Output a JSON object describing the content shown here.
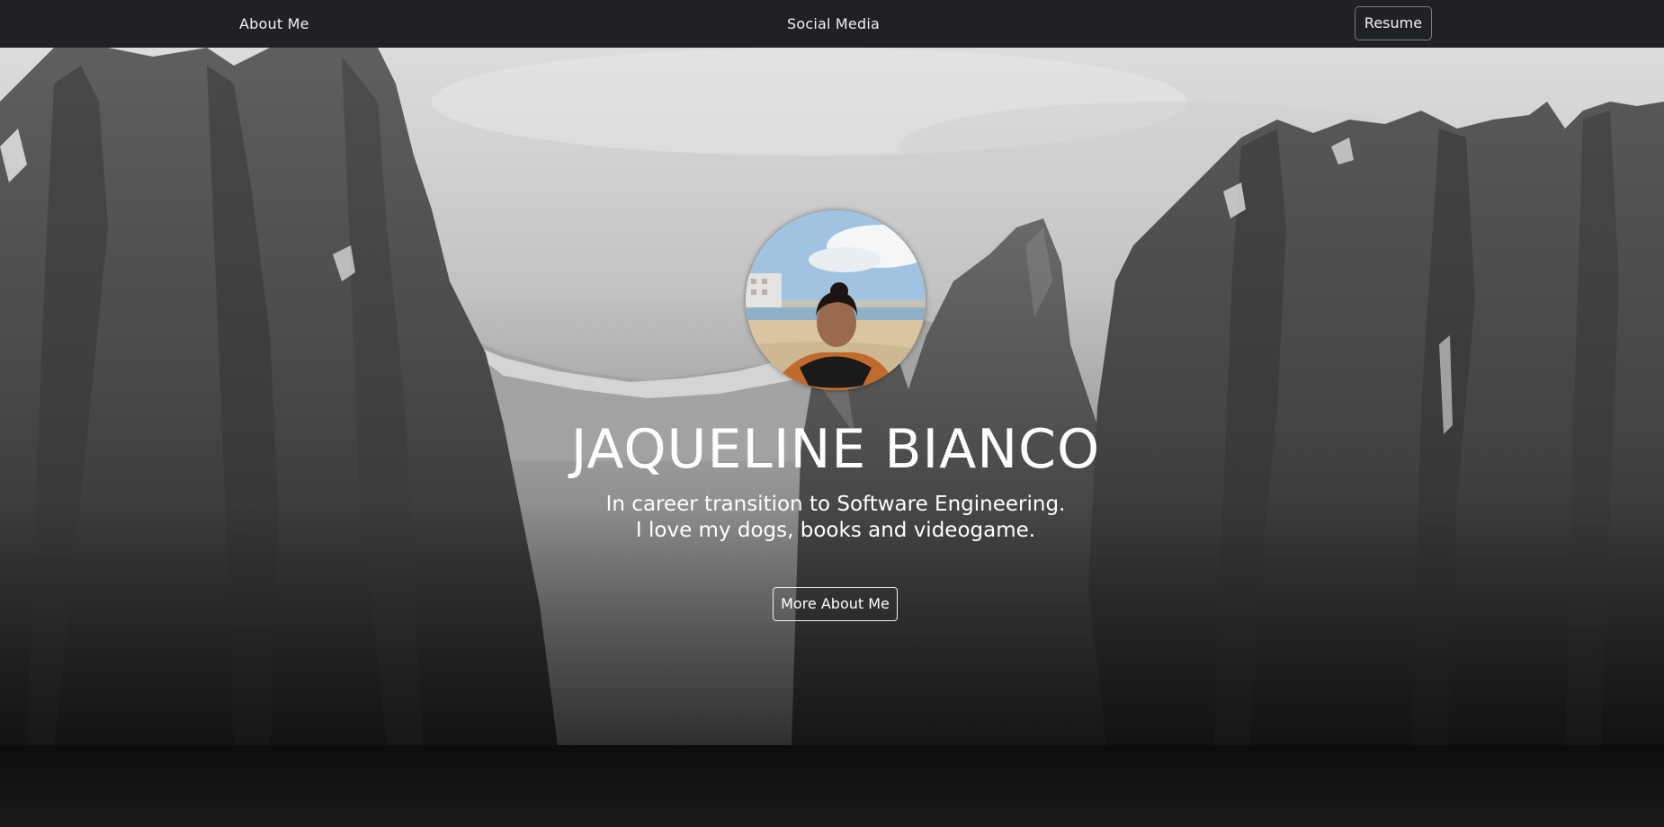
{
  "nav": {
    "about_label": "About Me",
    "social_label": "Social Media",
    "resume_label": "Resume"
  },
  "hero": {
    "name": "JAQUELINE BIANCO",
    "subtitle_line1": "In career transition to Software Engineering.",
    "subtitle_line2": "I love my dogs, books and videogame.",
    "cta_label": "More About Me"
  },
  "colors": {
    "navbar_bg": "#1f2125",
    "text": "#ffffff",
    "footer_bg": "#121414"
  },
  "images": {
    "background": "grayscale-mountain-landscape",
    "avatar": "profile-photo-on-beach"
  }
}
